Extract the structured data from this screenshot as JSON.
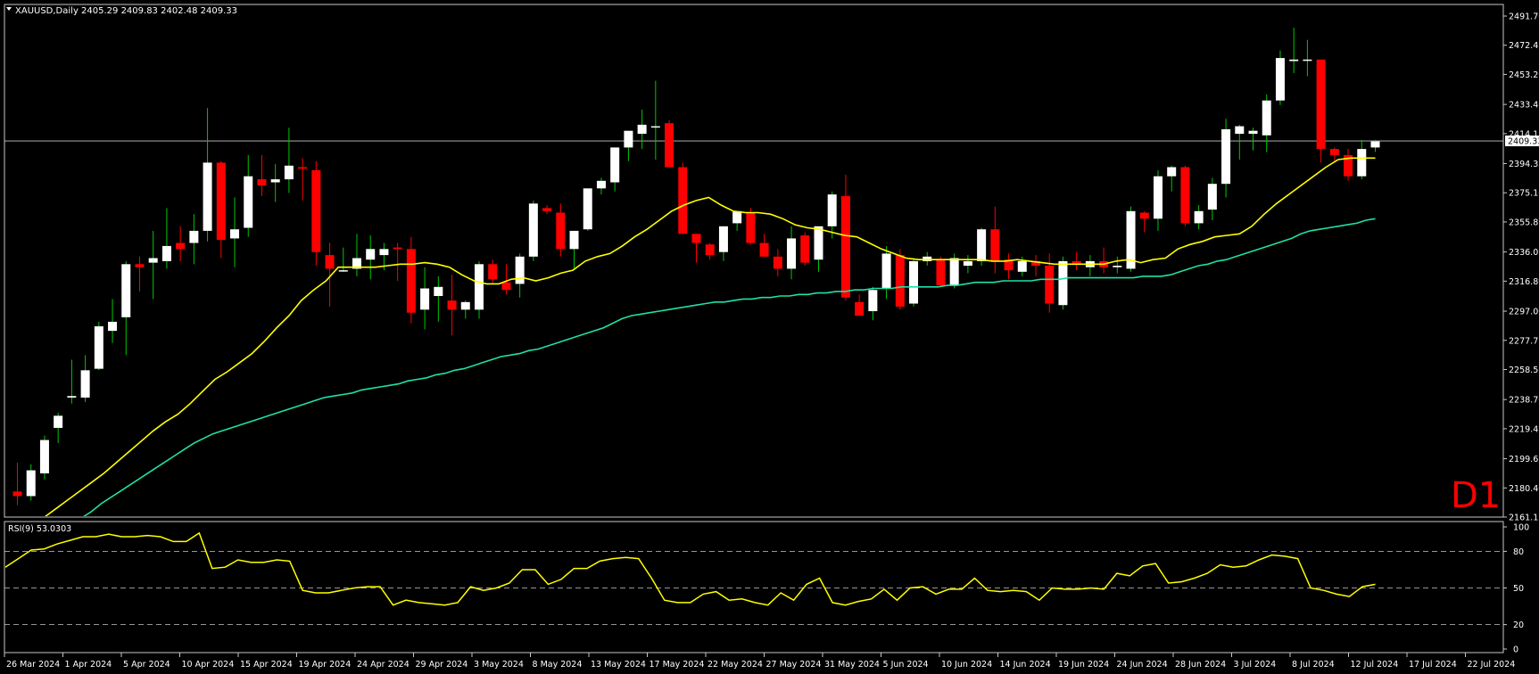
{
  "header": {
    "symbol_line": "XAUUSD,Daily  2405.29 2409.83 2402.48 2409.33",
    "rsi_label": "RSI(9) 53.0303",
    "timeframe_badge": "D1"
  },
  "colors": {
    "background": "#000000",
    "frame": "#c8c8c8",
    "bull_candle": "#ffffff",
    "bear_candle": "#ff0000",
    "wick_up": "#00c800",
    "wick_down": "#ff0000",
    "ma_fast": "#ffff00",
    "ma_slow": "#20e0a8",
    "rsi_line": "#ffff00",
    "text": "#ffffff",
    "badge": "#ff0000",
    "level_line": "#c8c8c8"
  },
  "chart_data": [
    {
      "type": "candlestick",
      "symbol": "XAUUSD",
      "timeframe": "Daily",
      "ylim": [
        2161.15,
        2491.7
      ],
      "y_ticks": [
        "2491.70",
        "2472.45",
        "2453.20",
        "2433.40",
        "2414.15",
        "2394.35",
        "2375.10",
        "2355.85",
        "2336.05",
        "2316.80",
        "2297.00",
        "2277.75",
        "2258.50",
        "2238.70",
        "2219.45",
        "2199.65",
        "2180.40",
        "2161.15"
      ],
      "current_price": "2409.33",
      "x_ticks": [
        "26 Mar 2024",
        "1 Apr 2024",
        "5 Apr 2024",
        "10 Apr 2024",
        "15 Apr 2024",
        "19 Apr 2024",
        "24 Apr 2024",
        "29 Apr 2024",
        "3 May 2024",
        "8 May 2024",
        "13 May 2024",
        "17 May 2024",
        "22 May 2024",
        "27 May 2024",
        "31 May 2024",
        "5 Jun 2024",
        "10 Jun 2024",
        "14 Jun 2024",
        "19 Jun 2024",
        "24 Jun 2024",
        "28 Jun 2024",
        "3 Jul 2024",
        "8 Jul 2024",
        "12 Jul 2024",
        "17 Jul 2024",
        "22 Jul 2024"
      ],
      "candles": [
        {
          "o": 2178,
          "h": 2197,
          "l": 2169,
          "c": 2175
        },
        {
          "o": 2175,
          "h": 2196,
          "l": 2172,
          "c": 2192
        },
        {
          "o": 2190,
          "h": 2215,
          "l": 2186,
          "c": 2212
        },
        {
          "o": 2220,
          "h": 2230,
          "l": 2210,
          "c": 2228
        },
        {
          "o": 2240,
          "h": 2265,
          "l": 2236,
          "c": 2241
        },
        {
          "o": 2240,
          "h": 2268,
          "l": 2237,
          "c": 2258
        },
        {
          "o": 2259,
          "h": 2290,
          "l": 2258,
          "c": 2287
        },
        {
          "o": 2284,
          "h": 2305,
          "l": 2276,
          "c": 2290
        },
        {
          "o": 2293,
          "h": 2330,
          "l": 2268,
          "c": 2328
        },
        {
          "o": 2328,
          "h": 2333,
          "l": 2310,
          "c": 2326
        },
        {
          "o": 2329,
          "h": 2350,
          "l": 2305,
          "c": 2332
        },
        {
          "o": 2330,
          "h": 2365,
          "l": 2325,
          "c": 2340
        },
        {
          "o": 2342,
          "h": 2353,
          "l": 2330,
          "c": 2338
        },
        {
          "o": 2342,
          "h": 2361,
          "l": 2328,
          "c": 2350
        },
        {
          "o": 2350,
          "h": 2431,
          "l": 2343,
          "c": 2395
        },
        {
          "o": 2395,
          "h": 2396,
          "l": 2332,
          "c": 2344
        },
        {
          "o": 2345,
          "h": 2372,
          "l": 2326,
          "c": 2351
        },
        {
          "o": 2352,
          "h": 2400,
          "l": 2346,
          "c": 2386
        },
        {
          "o": 2384,
          "h": 2400,
          "l": 2373,
          "c": 2380
        },
        {
          "o": 2382,
          "h": 2394,
          "l": 2369,
          "c": 2384
        },
        {
          "o": 2384,
          "h": 2418,
          "l": 2375,
          "c": 2393
        },
        {
          "o": 2392,
          "h": 2398,
          "l": 2370,
          "c": 2391
        },
        {
          "o": 2390,
          "h": 2396,
          "l": 2327,
          "c": 2336
        },
        {
          "o": 2334,
          "h": 2342,
          "l": 2300,
          "c": 2325
        },
        {
          "o": 2324,
          "h": 2339,
          "l": 2323,
          "c": 2324
        },
        {
          "o": 2325,
          "h": 2348,
          "l": 2320,
          "c": 2332
        },
        {
          "o": 2331,
          "h": 2347,
          "l": 2318,
          "c": 2338
        },
        {
          "o": 2334,
          "h": 2342,
          "l": 2324,
          "c": 2338
        },
        {
          "o": 2339,
          "h": 2342,
          "l": 2317,
          "c": 2338
        },
        {
          "o": 2338,
          "h": 2346,
          "l": 2289,
          "c": 2296
        },
        {
          "o": 2298,
          "h": 2326,
          "l": 2285,
          "c": 2312
        },
        {
          "o": 2307,
          "h": 2320,
          "l": 2290,
          "c": 2313
        },
        {
          "o": 2304,
          "h": 2321,
          "l": 2281,
          "c": 2298
        },
        {
          "o": 2298,
          "h": 2304,
          "l": 2292,
          "c": 2303
        },
        {
          "o": 2298,
          "h": 2330,
          "l": 2292,
          "c": 2328
        },
        {
          "o": 2328,
          "h": 2331,
          "l": 2315,
          "c": 2318
        },
        {
          "o": 2316,
          "h": 2328,
          "l": 2308,
          "c": 2311
        },
        {
          "o": 2315,
          "h": 2335,
          "l": 2306,
          "c": 2333
        },
        {
          "o": 2333,
          "h": 2370,
          "l": 2330,
          "c": 2368
        },
        {
          "o": 2365,
          "h": 2367,
          "l": 2361,
          "c": 2363
        },
        {
          "o": 2362,
          "h": 2368,
          "l": 2333,
          "c": 2338
        },
        {
          "o": 2338,
          "h": 2345,
          "l": 2324,
          "c": 2350
        },
        {
          "o": 2351,
          "h": 2374,
          "l": 2350,
          "c": 2378
        },
        {
          "o": 2378,
          "h": 2385,
          "l": 2374,
          "c": 2383
        },
        {
          "o": 2382,
          "h": 2393,
          "l": 2376,
          "c": 2405
        },
        {
          "o": 2405,
          "h": 2409,
          "l": 2396,
          "c": 2416
        },
        {
          "o": 2414,
          "h": 2430,
          "l": 2404,
          "c": 2420
        },
        {
          "o": 2419,
          "h": 2449,
          "l": 2397,
          "c": 2419
        },
        {
          "o": 2421,
          "h": 2423,
          "l": 2403,
          "c": 2392
        },
        {
          "o": 2392,
          "h": 2395,
          "l": 2369,
          "c": 2348
        },
        {
          "o": 2348,
          "h": 2348,
          "l": 2329,
          "c": 2342
        },
        {
          "o": 2341,
          "h": 2342,
          "l": 2331,
          "c": 2334
        },
        {
          "o": 2336,
          "h": 2345,
          "l": 2330,
          "c": 2353
        },
        {
          "o": 2355,
          "h": 2362,
          "l": 2350,
          "c": 2363
        },
        {
          "o": 2362,
          "h": 2365,
          "l": 2341,
          "c": 2342
        },
        {
          "o": 2342,
          "h": 2348,
          "l": 2333,
          "c": 2333
        },
        {
          "o": 2333,
          "h": 2338,
          "l": 2320,
          "c": 2325
        },
        {
          "o": 2325,
          "h": 2353,
          "l": 2318,
          "c": 2345
        },
        {
          "o": 2347,
          "h": 2349,
          "l": 2327,
          "c": 2329
        },
        {
          "o": 2331,
          "h": 2353,
          "l": 2323,
          "c": 2353
        },
        {
          "o": 2353,
          "h": 2376,
          "l": 2345,
          "c": 2374
        },
        {
          "o": 2373,
          "h": 2387,
          "l": 2304,
          "c": 2306
        },
        {
          "o": 2303,
          "h": 2308,
          "l": 2294,
          "c": 2294
        },
        {
          "o": 2297,
          "h": 2313,
          "l": 2291,
          "c": 2311
        },
        {
          "o": 2312,
          "h": 2340,
          "l": 2305,
          "c": 2335
        },
        {
          "o": 2334,
          "h": 2338,
          "l": 2298,
          "c": 2300
        },
        {
          "o": 2302,
          "h": 2332,
          "l": 2300,
          "c": 2330
        },
        {
          "o": 2330,
          "h": 2336,
          "l": 2327,
          "c": 2333
        },
        {
          "o": 2331,
          "h": 2333,
          "l": 2313,
          "c": 2314
        },
        {
          "o": 2314,
          "h": 2335,
          "l": 2312,
          "c": 2332
        },
        {
          "o": 2327,
          "h": 2334,
          "l": 2322,
          "c": 2330
        },
        {
          "o": 2330,
          "h": 2352,
          "l": 2327,
          "c": 2351
        },
        {
          "o": 2351,
          "h": 2366,
          "l": 2322,
          "c": 2330
        },
        {
          "o": 2331,
          "h": 2335,
          "l": 2318,
          "c": 2324
        },
        {
          "o": 2323,
          "h": 2333,
          "l": 2320,
          "c": 2330
        },
        {
          "o": 2330,
          "h": 2334,
          "l": 2320,
          "c": 2327
        },
        {
          "o": 2327,
          "h": 2335,
          "l": 2296,
          "c": 2302
        },
        {
          "o": 2301,
          "h": 2333,
          "l": 2298,
          "c": 2330
        },
        {
          "o": 2330,
          "h": 2336,
          "l": 2324,
          "c": 2328
        },
        {
          "o": 2326,
          "h": 2334,
          "l": 2320,
          "c": 2330
        },
        {
          "o": 2330,
          "h": 2339,
          "l": 2322,
          "c": 2326
        },
        {
          "o": 2326,
          "h": 2333,
          "l": 2322,
          "c": 2327
        },
        {
          "o": 2325,
          "h": 2366,
          "l": 2323,
          "c": 2363
        },
        {
          "o": 2362,
          "h": 2363,
          "l": 2349,
          "c": 2358
        },
        {
          "o": 2358,
          "h": 2390,
          "l": 2350,
          "c": 2386
        },
        {
          "o": 2386,
          "h": 2393,
          "l": 2376,
          "c": 2392
        },
        {
          "o": 2392,
          "h": 2393,
          "l": 2353,
          "c": 2355
        },
        {
          "o": 2355,
          "h": 2367,
          "l": 2351,
          "c": 2363
        },
        {
          "o": 2364,
          "h": 2385,
          "l": 2357,
          "c": 2381
        },
        {
          "o": 2381,
          "h": 2424,
          "l": 2372,
          "c": 2417
        },
        {
          "o": 2414,
          "h": 2420,
          "l": 2397,
          "c": 2419
        },
        {
          "o": 2414,
          "h": 2418,
          "l": 2403,
          "c": 2416
        },
        {
          "o": 2413,
          "h": 2440,
          "l": 2402,
          "c": 2436
        },
        {
          "o": 2436,
          "h": 2469,
          "l": 2433,
          "c": 2464
        },
        {
          "o": 2462,
          "h": 2484,
          "l": 2454,
          "c": 2463
        },
        {
          "o": 2463,
          "h": 2476,
          "l": 2452,
          "c": 2463
        },
        {
          "o": 2463,
          "h": 2463,
          "l": 2395,
          "c": 2404
        },
        {
          "o": 2404,
          "h": 2405,
          "l": 2395,
          "c": 2400
        },
        {
          "o": 2400,
          "h": 2404,
          "l": 2383,
          "c": 2386
        },
        {
          "o": 2386,
          "h": 2410,
          "l": 2384,
          "c": 2404
        },
        {
          "o": 2405,
          "h": 2410,
          "l": 2402,
          "c": 2409
        }
      ],
      "ma_fast": [
        2151,
        2155,
        2160,
        2166,
        2172,
        2178,
        2184,
        2190,
        2197,
        2204,
        2211,
        2218,
        2224,
        2229,
        2236,
        2244,
        2252,
        2257,
        2263,
        2269,
        2277,
        2286,
        2294,
        2304,
        2311,
        2317,
        2326,
        2326,
        2326,
        2326,
        2327,
        2328,
        2328,
        2329,
        2328,
        2326,
        2321,
        2317,
        2315,
        2315,
        2318,
        2319,
        2317,
        2319,
        2322,
        2324,
        2330,
        2333,
        2335,
        2340,
        2346,
        2351,
        2357,
        2363,
        2367,
        2370,
        2372,
        2367,
        2363,
        2362,
        2362,
        2361,
        2358,
        2354,
        2352,
        2351,
        2349,
        2347,
        2346,
        2342,
        2338,
        2335,
        2332,
        2331,
        2331,
        2331,
        2331,
        2331,
        2331,
        2330,
        2330,
        2331,
        2330,
        2329,
        2328,
        2328,
        2328,
        2328,
        2328,
        2330,
        2331,
        2329,
        2331,
        2332,
        2338,
        2341,
        2343,
        2346,
        2347,
        2348,
        2353,
        2361,
        2368,
        2374,
        2380,
        2386,
        2392,
        2397,
        2398,
        2398,
        2398
      ],
      "ma_slow": [
        2132,
        2135,
        2139,
        2143,
        2148,
        2152,
        2157,
        2161,
        2165,
        2170,
        2174,
        2178,
        2182,
        2186,
        2190,
        2194,
        2198,
        2202,
        2206,
        2210,
        2213,
        2216,
        2218,
        2220,
        2222,
        2224,
        2226,
        2228,
        2230,
        2232,
        2234,
        2236,
        2238,
        2240,
        2241,
        2242,
        2243,
        2245,
        2246,
        2247,
        2248,
        2249,
        2251,
        2252,
        2253,
        2255,
        2256,
        2258,
        2259,
        2261,
        2263,
        2265,
        2267,
        2268,
        2269,
        2271,
        2272,
        2274,
        2276,
        2278,
        2280,
        2282,
        2284,
        2286,
        2289,
        2292,
        2294,
        2295,
        2296,
        2297,
        2298,
        2299,
        2300,
        2301,
        2302,
        2303,
        2303,
        2304,
        2305,
        2305,
        2306,
        2306,
        2307,
        2307,
        2308,
        2308,
        2309,
        2309,
        2310,
        2310,
        2311,
        2311,
        2312,
        2312,
        2312,
        2313,
        2313,
        2313,
        2313,
        2313,
        2314,
        2314,
        2315,
        2316,
        2316,
        2316,
        2317,
        2317,
        2317,
        2317,
        2318,
        2318,
        2318,
        2319,
        2319,
        2319,
        2319,
        2319,
        2319,
        2319,
        2319,
        2320,
        2320,
        2320,
        2321,
        2323,
        2325,
        2327,
        2328,
        2330,
        2331,
        2333,
        2335,
        2337,
        2339,
        2341,
        2343,
        2345,
        2348,
        2350,
        2351,
        2352,
        2353,
        2354,
        2355,
        2357,
        2358
      ]
    },
    {
      "type": "line",
      "name": "RSI(9)",
      "value_label": "53.0303",
      "ylim": [
        0,
        100
      ],
      "y_ticks": [
        "100",
        "80",
        "50",
        "20",
        "0"
      ],
      "levels": [
        80,
        50,
        20
      ],
      "values": [
        67,
        74,
        81,
        82,
        86,
        89,
        92,
        92,
        94,
        92,
        92,
        93,
        92,
        88,
        88,
        95,
        66,
        67,
        73,
        71,
        71,
        73,
        72,
        48,
        46,
        46,
        48,
        50,
        51,
        51,
        36,
        40,
        38,
        37,
        36,
        38,
        51,
        48,
        50,
        54,
        65,
        65,
        53,
        57,
        66,
        66,
        72,
        74,
        75,
        74,
        58,
        40,
        38,
        38,
        45,
        47,
        40,
        41,
        38,
        36,
        46,
        40,
        53,
        58,
        38,
        36,
        39,
        41,
        49,
        40,
        50,
        51,
        45,
        49,
        49,
        58,
        48,
        47,
        48,
        47,
        40,
        50,
        49,
        49,
        50,
        49,
        62,
        60,
        68,
        70,
        54,
        55,
        58,
        62,
        69,
        67,
        68,
        73,
        77,
        76,
        74,
        50,
        48,
        45,
        43,
        51,
        53
      ]
    }
  ]
}
